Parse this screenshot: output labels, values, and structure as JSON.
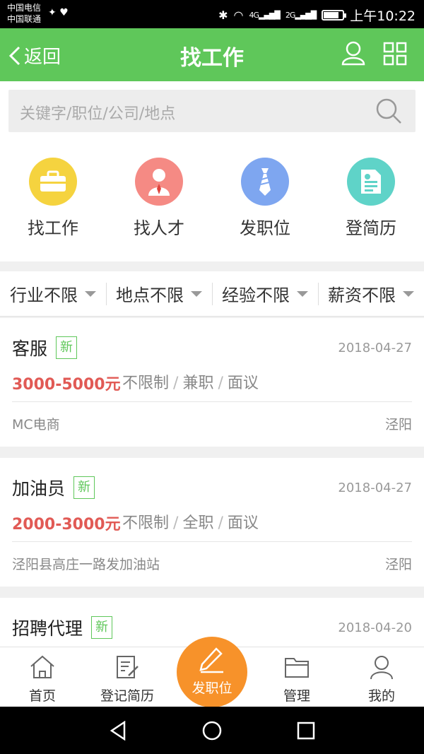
{
  "status_bar": {
    "carrier_1": "中国电信",
    "carrier_2": "中国联通",
    "net_1": "4G",
    "net_2": "2G",
    "time": "上午10:22"
  },
  "header": {
    "back_label": "返回",
    "title": "找工作",
    "bg_color": "#5fc75a"
  },
  "search": {
    "placeholder": "关键字/职位/公司/地点"
  },
  "quick_actions": [
    {
      "label": "找工作",
      "icon": "briefcase-icon",
      "color": "#f5d33f"
    },
    {
      "label": "找人才",
      "icon": "person-icon",
      "color": "#f58a84"
    },
    {
      "label": "发职位",
      "icon": "tie-icon",
      "color": "#7ea6f0"
    },
    {
      "label": "登简历",
      "icon": "resume-icon",
      "color": "#5fd3c8"
    }
  ],
  "filters": [
    {
      "label": "行业不限"
    },
    {
      "label": "地点不限"
    },
    {
      "label": "经验不限"
    },
    {
      "label": "薪资不限"
    }
  ],
  "jobs": [
    {
      "title": "客服",
      "badge": "新",
      "date": "2018-04-27",
      "salary": "3000-5000元",
      "req": "不限制",
      "type": "兼职",
      "pay": "面议",
      "company": "MC电商",
      "location": "泾阳"
    },
    {
      "title": "加油员",
      "badge": "新",
      "date": "2018-04-27",
      "salary": "2000-3000元",
      "req": "不限制",
      "type": "全职",
      "pay": "面议",
      "company": "泾阳县高庄一路发加油站",
      "location": "泾阳"
    },
    {
      "title": "招聘代理",
      "badge": "新",
      "date": "2018-04-20"
    }
  ],
  "separator": "/",
  "bottom_nav": [
    {
      "label": "首页",
      "icon": "home-icon"
    },
    {
      "label": "登记简历",
      "icon": "edit-doc-icon"
    },
    {
      "label": "发职位",
      "icon": "pencil-icon"
    },
    {
      "label": "管理",
      "icon": "folder-icon"
    },
    {
      "label": "我的",
      "icon": "user-icon"
    }
  ],
  "colors": {
    "accent_green": "#5fc75a",
    "salary_red": "#e15a55",
    "post_orange": "#f7922a"
  }
}
